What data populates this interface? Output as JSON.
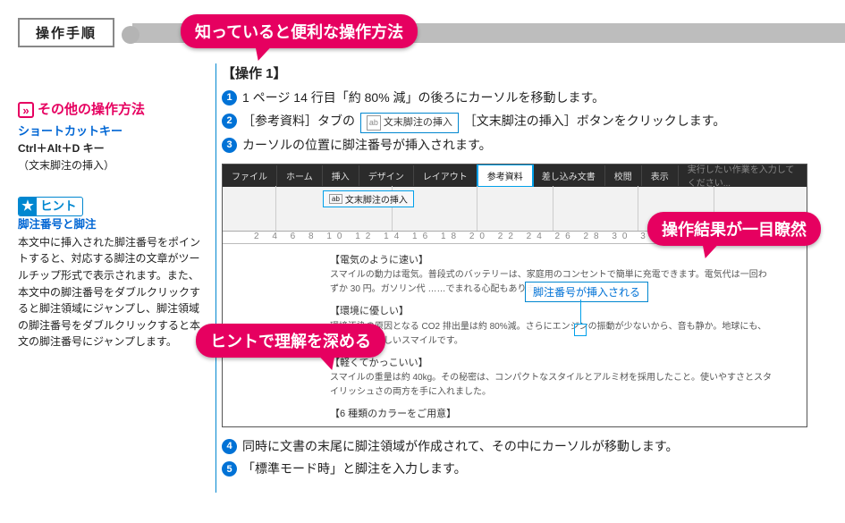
{
  "heading": "操作手順",
  "callouts": {
    "c1": "知っていると便利な操作方法",
    "c2": "ヒントで理解を深める",
    "c3": "操作結果が一目瞭然"
  },
  "sidebar": {
    "other": {
      "label": "その他の操作方法",
      "sub1": "ショートカットキー",
      "sub2": "Ctrl＋Alt＋D キー",
      "note": "（文末脚注の挿入）"
    },
    "hint": {
      "label": "ヒント",
      "sub": "脚注番号と脚注",
      "body": "本文中に挿入された脚注番号をポイントすると、対応する脚注の文章がツールチップ形式で表示されます。また、本文中の脚注番号をダブルクリックすると脚注領域にジャンプし、脚注領域の脚注番号をダブルクリックすると本文の脚注番号にジャンプします。"
    }
  },
  "ops": {
    "title": "【操作 1】",
    "s1": "1 ページ 14 行目「約 80% 減」の後ろにカーソルを移動します。",
    "s2a": "［参考資料］タブの",
    "s2btn": "文末脚注の挿入",
    "s2b": "［文末脚注の挿入］ボタンをクリックします。",
    "s3": "カーソルの位置に脚注番号が挿入されます。",
    "s4": "同時に文書の末尾に脚注領域が作成されて、その中にカーソルが移動します。",
    "s5": "「標準モード時」と脚注を入力します。"
  },
  "shot": {
    "tabs": [
      "ファイル",
      "ホーム",
      "挿入",
      "デザイン",
      "レイアウト",
      "参考資料",
      "差し込み文書",
      "校閲",
      "表示",
      "実行したい作業を入力してください..."
    ],
    "activeTab": "参考資料",
    "btn": "文末脚注の挿入",
    "doc": {
      "h1": "【電気のように速い】",
      "p1": "スマイルの動力は電気。普段式のバッテリーは、家庭用のコンセントで簡単に充電できます。電気代は一回わずか 30 円。ガソリン代 ……でまれる心配もありません。",
      "h2": "【環境に優しい】",
      "p2": "環境汚染の原因となる CO2 排出量は約 80%減。さらにエンジンの振動が少ないから、音も静か。地球にも、ご近所にも優しいスマイルです。",
      "h3": "【軽くてかっこいい】",
      "p3": "スマイルの重量は約 40kg。その秘密は、コンパクトなスタイルとアルミ材を採用したこと。使いやすさとスタイリッシュさの両方を手に入れました。",
      "h4": "【6 種類のカラーをご用意】"
    },
    "annot": "脚注番号が挿入される"
  }
}
